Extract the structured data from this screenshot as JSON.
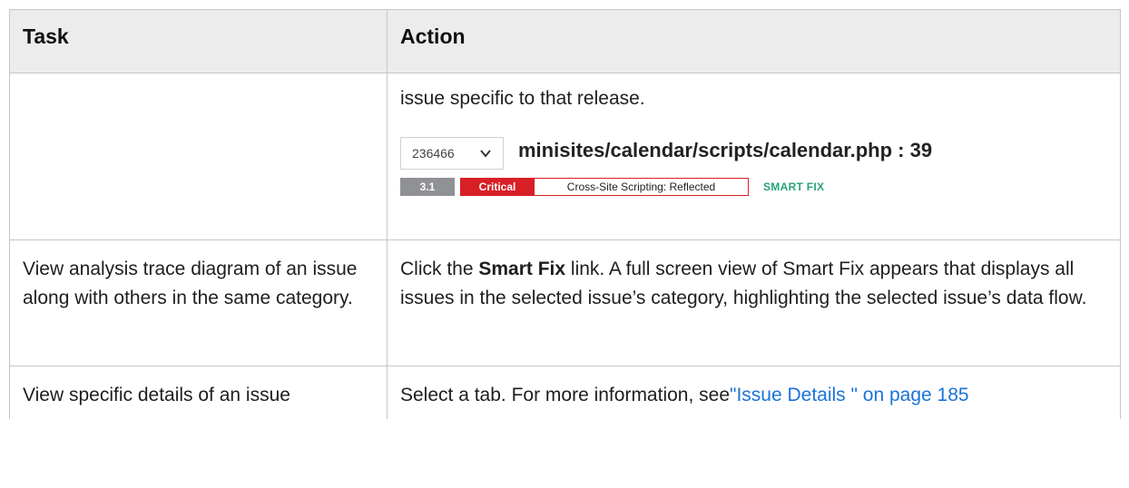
{
  "table": {
    "headers": {
      "task": "Task",
      "action": "Action"
    },
    "row1": {
      "task": "",
      "action_text": "issue specific to that release.",
      "snippet": {
        "release_value": "236466",
        "file_path": "minisites/calendar/scripts/calendar.php : 39",
        "score": "3.1",
        "severity": "Critical",
        "category": "Cross-Site Scripting: Reflected",
        "smart_fix": "SMART FIX",
        "severity_color": "#d91f26",
        "smart_fix_color": "#27a37a"
      }
    },
    "row2": {
      "task": "View analysis trace diagram of an issue along with others in the same category.",
      "action_prefix": "Click the ",
      "action_bold": "Smart Fix",
      "action_suffix": " link. A full screen view of Smart Fix appears that displays all issues in the selected issue’s category, highlighting the selected issue’s data flow."
    },
    "row3": {
      "task": "View specific details of an issue",
      "action_prefix": "Select a tab. For more information, see",
      "action_link": "\"Issue Details \" on page 185",
      "link_color": "#1a73d9"
    }
  }
}
